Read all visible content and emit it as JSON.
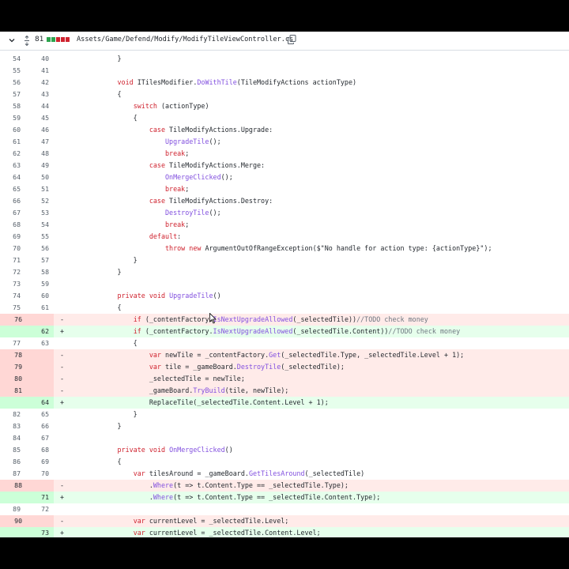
{
  "file_header": {
    "changes": "81",
    "diffstat_colors": [
      "#2da44e",
      "#2da44e",
      "#cf222e",
      "#cf222e",
      "#cf222e"
    ],
    "path": "Assets/Game/Defend/Modify/ModifyTileViewController.cs",
    "icons": [
      "chevron-down-icon",
      "expand-icon",
      "copy-icon"
    ]
  },
  "lines": [
    {
      "type": "ctx",
      "old": "54",
      "new": "40",
      "code": "            }"
    },
    {
      "type": "ctx",
      "old": "55",
      "new": "41",
      "code": ""
    },
    {
      "type": "ctx",
      "old": "56",
      "new": "42",
      "code": "            void ITilesModifier.DoWithTile(TileModifyActions actionType)"
    },
    {
      "type": "ctx",
      "old": "57",
      "new": "43",
      "code": "            {"
    },
    {
      "type": "ctx",
      "old": "58",
      "new": "44",
      "code": "                switch (actionType)"
    },
    {
      "type": "ctx",
      "old": "59",
      "new": "45",
      "code": "                {"
    },
    {
      "type": "ctx",
      "old": "60",
      "new": "46",
      "code": "                    case TileModifyActions.Upgrade:"
    },
    {
      "type": "ctx",
      "old": "61",
      "new": "47",
      "code": "                        UpgradeTile();"
    },
    {
      "type": "ctx",
      "old": "62",
      "new": "48",
      "code": "                        break;"
    },
    {
      "type": "ctx",
      "old": "63",
      "new": "49",
      "code": "                    case TileModifyActions.Merge:"
    },
    {
      "type": "ctx",
      "old": "64",
      "new": "50",
      "code": "                        OnMergeClicked();"
    },
    {
      "type": "ctx",
      "old": "65",
      "new": "51",
      "code": "                        break;"
    },
    {
      "type": "ctx",
      "old": "66",
      "new": "52",
      "code": "                    case TileModifyActions.Destroy:"
    },
    {
      "type": "ctx",
      "old": "67",
      "new": "53",
      "code": "                        DestroyTile();"
    },
    {
      "type": "ctx",
      "old": "68",
      "new": "54",
      "code": "                        break;"
    },
    {
      "type": "ctx",
      "old": "69",
      "new": "55",
      "code": "                    default:"
    },
    {
      "type": "ctx",
      "old": "70",
      "new": "56",
      "code": "                        throw new ArgumentOutOfRangeException($\"No handle for action type: {actionType}\");"
    },
    {
      "type": "ctx",
      "old": "71",
      "new": "57",
      "code": "                }"
    },
    {
      "type": "ctx",
      "old": "72",
      "new": "58",
      "code": "            }"
    },
    {
      "type": "ctx",
      "old": "73",
      "new": "59",
      "code": ""
    },
    {
      "type": "ctx",
      "old": "74",
      "new": "60",
      "code": "            private void UpgradeTile()"
    },
    {
      "type": "ctx",
      "old": "75",
      "new": "61",
      "code": "            {"
    },
    {
      "type": "del",
      "old": "76",
      "new": "",
      "sign": "-",
      "code": "                if (_contentFactory.IsNextUpgradeAllowed(_selectedTile))//TODO check money"
    },
    {
      "type": "add",
      "old": "",
      "new": "62",
      "sign": "+",
      "code": "                if (_contentFactory.IsNextUpgradeAllowed(_selectedTile.Content))//TODO check money"
    },
    {
      "type": "ctx",
      "old": "77",
      "new": "63",
      "code": "                {"
    },
    {
      "type": "del",
      "old": "78",
      "new": "",
      "sign": "-",
      "code": "                    var newTile = _contentFactory.Get(_selectedTile.Type, _selectedTile.Level + 1);"
    },
    {
      "type": "del",
      "old": "79",
      "new": "",
      "sign": "-",
      "code": "                    var tile = _gameBoard.DestroyTile(_selectedTile);"
    },
    {
      "type": "del",
      "old": "80",
      "new": "",
      "sign": "-",
      "code": "                    _selectedTile = newTile;"
    },
    {
      "type": "del",
      "old": "81",
      "new": "",
      "sign": "-",
      "code": "                    _gameBoard.TryBuild(tile, newTile);"
    },
    {
      "type": "add",
      "old": "",
      "new": "64",
      "sign": "+",
      "code": "                    ReplaceTile(_selectedTile.Content.Level + 1);"
    },
    {
      "type": "ctx",
      "old": "82",
      "new": "65",
      "code": "                }"
    },
    {
      "type": "ctx",
      "old": "83",
      "new": "66",
      "code": "            }"
    },
    {
      "type": "ctx",
      "old": "84",
      "new": "67",
      "code": ""
    },
    {
      "type": "ctx",
      "old": "85",
      "new": "68",
      "code": "            private void OnMergeClicked()"
    },
    {
      "type": "ctx",
      "old": "86",
      "new": "69",
      "code": "            {"
    },
    {
      "type": "ctx",
      "old": "87",
      "new": "70",
      "code": "                var tilesAround = _gameBoard.GetTilesAround(_selectedTile)"
    },
    {
      "type": "del",
      "old": "88",
      "new": "",
      "sign": "-",
      "code": "                    .Where(t => t.Content.Type == _selectedTile.Type);"
    },
    {
      "type": "add",
      "old": "",
      "new": "71",
      "sign": "+",
      "code": "                    .Where(t => t.Content.Type == _selectedTile.Content.Type);"
    },
    {
      "type": "ctx",
      "old": "89",
      "new": "72",
      "code": ""
    },
    {
      "type": "del",
      "old": "90",
      "new": "",
      "sign": "-",
      "code": "                var currentLevel = _selectedTile.Level;"
    },
    {
      "type": "add",
      "old": "",
      "new": "73",
      "sign": "+",
      "code": "                var currentLevel = _selectedTile.Content.Level;"
    }
  ],
  "colors": {
    "del_bg": "#ffebe9",
    "del_gutter": "#ffd7d5",
    "add_bg": "#e6ffec",
    "add_gutter": "#ccffd8",
    "add_highlight": "#abf2bc",
    "keyword": "#cf222e",
    "function": "#8250df",
    "comment": "#6e7781"
  }
}
